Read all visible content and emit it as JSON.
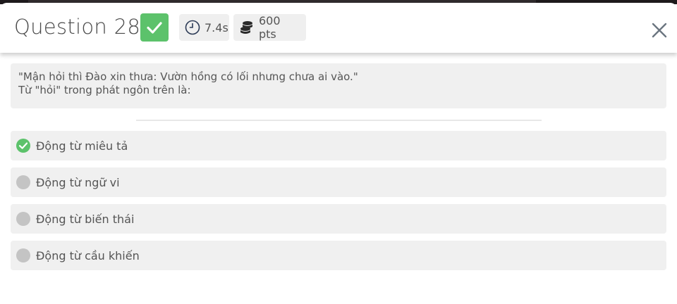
{
  "header": {
    "title": "Question 28",
    "time": "7.4s",
    "points": "600 pts"
  },
  "question": {
    "line1": "\"Mận hỏi thì Đào xin thưa: Vườn hồng có lối nhưng chưa ai vào.\"",
    "line2": "Từ \"hỏi\" trong phát ngôn trên là:"
  },
  "options": [
    {
      "label": "Động từ miêu tả",
      "status": "correct"
    },
    {
      "label": "Động từ ngữ vi",
      "status": "neutral"
    },
    {
      "label": "Động từ biến thái",
      "status": "neutral"
    },
    {
      "label": "Động từ cầu khiến",
      "status": "neutral"
    }
  ],
  "colors": {
    "correct": "#5cc26b",
    "neutral_dot": "#c4c4c4",
    "panel": "#f0f0f0"
  },
  "icons": {
    "correct_badge": "check-icon",
    "time": "clock-icon",
    "points": "coins-icon",
    "close": "close-icon"
  }
}
